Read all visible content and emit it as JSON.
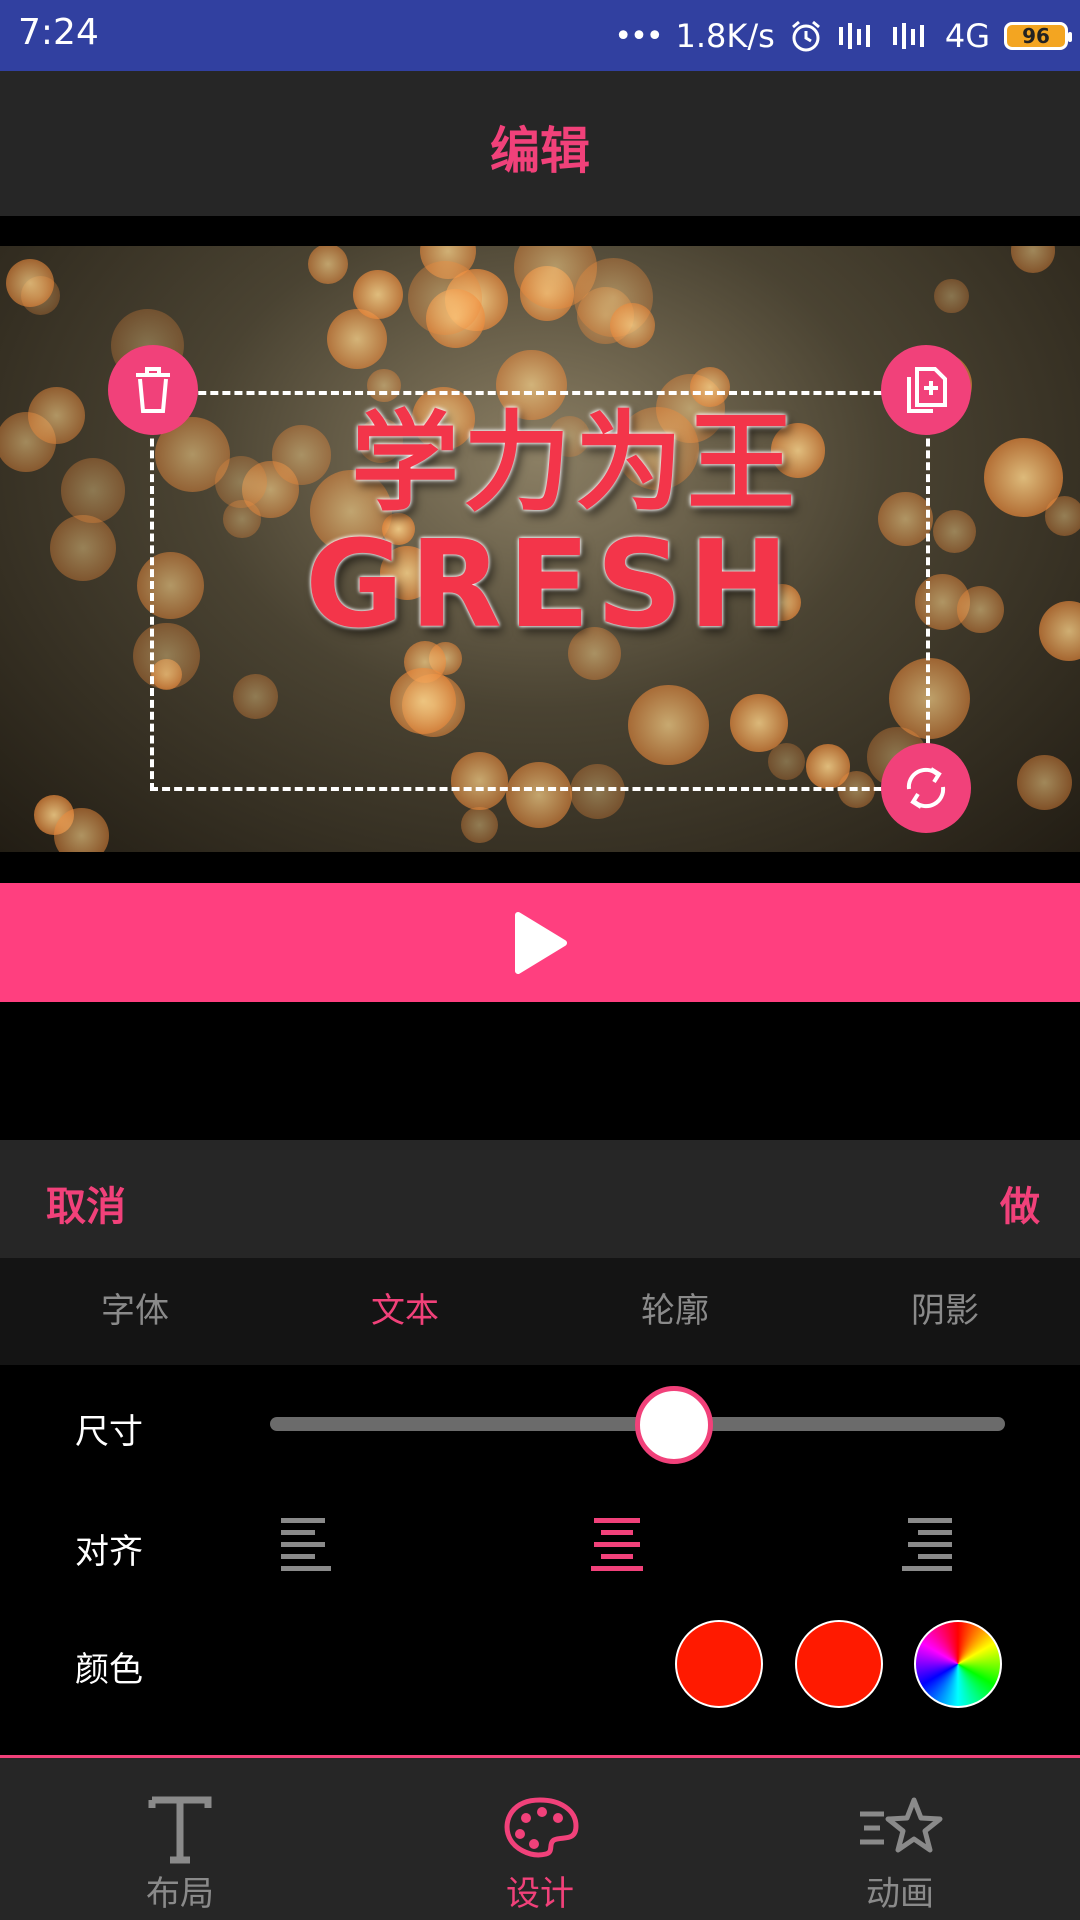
{
  "status": {
    "time": "7:24",
    "speed": "1.8K/s",
    "network": "4G",
    "battery": "96",
    "icons": [
      "dots-icon",
      "alarm-icon",
      "signal-icon",
      "signal-icon",
      "battery-icon"
    ]
  },
  "header": {
    "title": "编辑"
  },
  "preview": {
    "line1": "学力为王",
    "line2": "GRESH",
    "handles": [
      "trash-icon",
      "copy-icon",
      "rotate-icon"
    ]
  },
  "player": {
    "play_icon": "play-icon"
  },
  "actions": {
    "cancel": "取消",
    "done": "做"
  },
  "tabs": [
    {
      "label": "字体",
      "active": false
    },
    {
      "label": "文本",
      "active": true
    },
    {
      "label": "轮廓",
      "active": false
    },
    {
      "label": "阴影",
      "active": false
    }
  ],
  "controls": {
    "size_label": "尺寸",
    "size_value": 0.55,
    "align_label": "对齐",
    "align_options": [
      "align-left-icon",
      "align-center-icon",
      "align-right-icon"
    ],
    "align_selected": "center",
    "color_label": "颜色",
    "colors": [
      "#ff1a00",
      "#ff1a00",
      "color-wheel-icon"
    ]
  },
  "bottom_nav": [
    {
      "label": "布局",
      "icon": "text-icon",
      "active": false
    },
    {
      "label": "设计",
      "icon": "palette-icon",
      "active": true
    },
    {
      "label": "动画",
      "icon": "star-animation-icon",
      "active": false
    }
  ],
  "theme": {
    "accent": "#f1417a",
    "play_bar": "#ff3f7f",
    "status_bar": "#3140a0"
  }
}
